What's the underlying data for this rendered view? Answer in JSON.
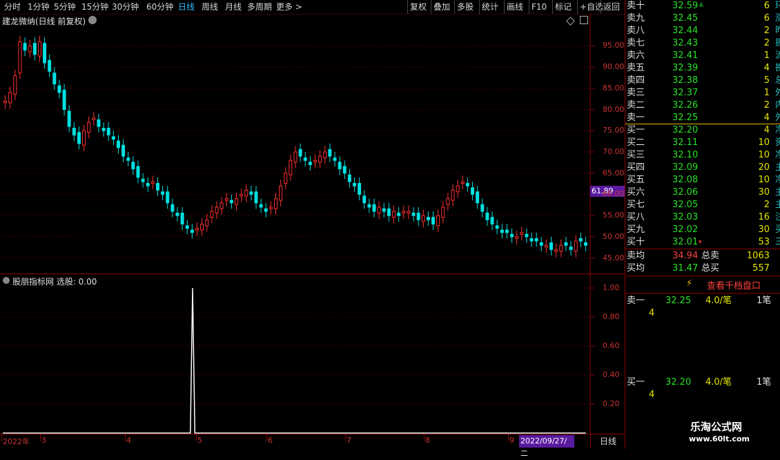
{
  "toolbar": {
    "periods": [
      "分时",
      "1分钟",
      "5分钟",
      "15分钟",
      "30分钟",
      "60分钟",
      "日线",
      "周线",
      "月线",
      "多周期",
      "更多 >"
    ],
    "active_period": "日线",
    "actions": [
      "复权",
      "叠加",
      "多股",
      "统计",
      "画线",
      "F10",
      "标记",
      "+自选",
      "返回"
    ]
  },
  "chart": {
    "title": "建龙微纳(日线 前复权)",
    "price_tag": "61.89",
    "yticks": [
      "95.00",
      "90.00",
      "85.00",
      "80.00",
      "75.00",
      "70.00",
      "65.00",
      "60.00",
      "55.00",
      "50.00",
      "45.00"
    ],
    "indicator_title": "股朋指标网 选股: 0.00",
    "indicator_yticks": [
      "1.00",
      "0.80",
      "0.60",
      "0.40",
      "0.20"
    ],
    "xlabels": [
      "2022年",
      "3",
      "4",
      "5",
      "6",
      "7",
      "8",
      "9"
    ],
    "cursor_date": "2022/09/27/二",
    "period_label": "日线"
  },
  "chart_data": {
    "type": "line",
    "title": "股朋指标网 选股",
    "values_note": "",
    "ylim": [
      0,
      1.0
    ],
    "series": [
      {
        "name": "选股",
        "values": [
          0,
          0,
          0,
          0,
          0,
          0,
          0,
          0,
          0,
          0,
          0,
          0,
          0,
          0,
          0,
          0,
          0,
          0,
          0,
          0,
          0,
          0,
          0,
          0,
          0,
          0,
          0,
          0,
          0,
          0,
          0,
          0,
          0,
          0,
          0,
          0,
          0,
          0,
          0,
          0,
          0,
          0,
          0,
          0,
          0,
          0,
          0,
          0,
          0,
          0,
          0,
          0,
          0,
          0,
          0,
          0,
          0,
          0,
          0,
          0,
          0,
          0,
          0,
          0,
          0,
          0,
          0,
          0,
          0,
          0,
          0,
          0,
          0,
          0,
          0,
          0,
          0,
          0,
          0,
          0,
          0,
          0,
          0,
          0,
          1,
          0,
          0,
          0,
          0,
          0,
          0,
          0,
          0,
          0,
          0,
          0,
          0,
          0,
          0,
          0,
          0,
          0,
          0,
          0,
          0,
          0,
          0,
          0,
          0,
          0,
          0,
          0,
          0,
          0,
          0,
          0,
          0,
          0,
          0,
          0,
          0,
          0,
          0,
          0,
          0,
          0,
          0,
          0,
          0,
          0,
          0,
          0,
          0,
          0,
          0,
          0,
          0,
          0,
          0,
          0,
          0,
          0,
          0,
          0,
          0,
          0,
          0,
          0,
          0,
          0,
          0,
          0,
          0,
          0,
          0,
          0,
          0,
          0,
          0,
          0,
          0,
          0,
          0,
          0,
          0,
          0,
          0,
          0,
          0,
          0,
          0,
          0,
          0,
          0,
          0,
          0,
          0,
          0,
          0,
          0,
          0,
          0,
          0,
          0,
          0,
          0,
          0,
          0,
          0,
          0,
          0,
          0,
          0,
          0,
          0,
          0,
          0,
          0,
          0,
          0,
          0,
          0,
          0,
          0,
          0,
          0,
          0,
          0,
          0,
          0,
          0,
          0,
          0,
          0,
          0,
          0,
          0,
          0,
          0,
          0,
          0,
          0,
          0,
          0,
          0,
          0,
          0,
          0,
          0,
          0,
          0,
          0,
          0,
          0,
          0,
          0,
          0,
          0,
          0,
          0,
          0,
          0,
          0,
          0,
          0,
          0,
          0,
          0,
          0,
          0,
          0,
          0,
          0,
          0,
          0,
          0,
          0,
          0,
          0
        ]
      }
    ],
    "price_close": [
      82,
      84,
      88,
      96,
      94,
      95,
      93,
      96,
      91,
      89,
      86,
      84,
      80,
      76,
      74,
      72,
      75,
      77,
      78,
      76,
      75,
      74,
      73,
      71,
      69,
      68,
      66,
      64,
      63,
      62,
      63,
      61,
      60,
      58,
      56,
      55,
      53,
      52,
      51,
      52,
      53,
      54,
      56,
      57,
      58,
      59,
      58,
      59,
      60,
      61,
      60,
      58,
      57,
      56,
      57,
      59,
      62,
      65,
      68,
      70,
      69,
      68,
      67,
      68,
      69,
      70,
      69,
      68,
      66,
      65,
      63,
      62,
      60,
      58,
      57,
      56,
      57,
      56,
      55,
      56,
      55,
      56,
      56,
      55,
      54,
      55,
      54,
      53,
      55,
      57,
      59,
      61,
      62,
      63,
      62,
      60,
      58,
      56,
      54,
      53,
      52,
      51,
      51,
      50,
      50,
      51,
      50,
      49,
      49,
      48,
      48,
      47,
      47,
      48,
      48,
      47,
      49,
      49,
      48
    ]
  },
  "quote": {
    "asks": [
      {
        "label": "卖十",
        "price": "32.59",
        "flag": "≛",
        "vol": "6",
        "cut": "环"
      },
      {
        "label": "卖九",
        "price": "32.45",
        "flag": "",
        "vol": "6",
        "cut": "涨"
      },
      {
        "label": "卖八",
        "price": "32.44",
        "flag": "",
        "vol": "2",
        "cut": "昨"
      },
      {
        "label": "卖七",
        "price": "32.43",
        "flag": "",
        "vol": "2",
        "cut": "振"
      },
      {
        "label": "卖六",
        "price": "32.41",
        "flag": "",
        "vol": "1",
        "cut": "流"
      },
      {
        "label": "卖五",
        "price": "32.39",
        "flag": "",
        "vol": "4",
        "cut": "换"
      },
      {
        "label": "卖四",
        "price": "32.38",
        "flag": "",
        "vol": "5",
        "cut": "总"
      },
      {
        "label": "卖三",
        "price": "32.37",
        "flag": "",
        "vol": "1",
        "cut": "外"
      },
      {
        "label": "卖二",
        "price": "32.26",
        "flag": "",
        "vol": "2",
        "cut": "内"
      },
      {
        "label": "卖一",
        "price": "32.25",
        "flag": "",
        "vol": "4",
        "cut": "外"
      }
    ],
    "bids": [
      {
        "label": "买一",
        "price": "32.20",
        "flag": "",
        "vol": "4",
        "cut": "净"
      },
      {
        "label": "买二",
        "price": "32.11",
        "flag": "",
        "vol": "10",
        "cut": "资"
      },
      {
        "label": "买三",
        "price": "32.10",
        "flag": "",
        "vol": "10",
        "cut": "净"
      },
      {
        "label": "买四",
        "price": "32.09",
        "flag": "",
        "vol": "20",
        "cut": "主"
      },
      {
        "label": "买五",
        "price": "32.08",
        "flag": "",
        "vol": "10",
        "cut": "净"
      },
      {
        "label": "买六",
        "price": "32.06",
        "flag": "",
        "vol": "30",
        "cut": "主"
      },
      {
        "label": "买七",
        "price": "32.05",
        "flag": "",
        "vol": "2",
        "cut": "主"
      },
      {
        "label": "买八",
        "price": "32.03",
        "flag": "",
        "vol": "16",
        "cut": "注"
      },
      {
        "label": "买九",
        "price": "32.02",
        "flag": "",
        "vol": "30",
        "cut": "买"
      },
      {
        "label": "买十",
        "price": "32.01",
        "flag": "▾",
        "vol": "53",
        "cut": "三"
      }
    ],
    "avg_sell_label": "卖均",
    "avg_sell": "34.94",
    "total_sell_label": "总卖",
    "total_sell": "1063",
    "avg_buy_label": "买均",
    "avg_buy": "31.47",
    "total_buy_label": "总买",
    "total_buy": "557",
    "depth_link": "查看千档盘口",
    "detail_sell": {
      "label": "卖一",
      "price": "32.25",
      "per": "4.0/笔",
      "count": "1笔",
      "vol": "4"
    },
    "detail_buy": {
      "label": "买一",
      "price": "32.20",
      "per": "4.0/笔",
      "count": "1笔",
      "vol": "4"
    }
  },
  "watermark": {
    "line1": "乐淘公式网",
    "line2": "www.60lt.com"
  },
  "colors": {
    "up": "#ff3030",
    "down": "#00e0e0",
    "ask_price": "#28e028",
    "volume": "#e6e600",
    "grid": "#5a0000"
  }
}
